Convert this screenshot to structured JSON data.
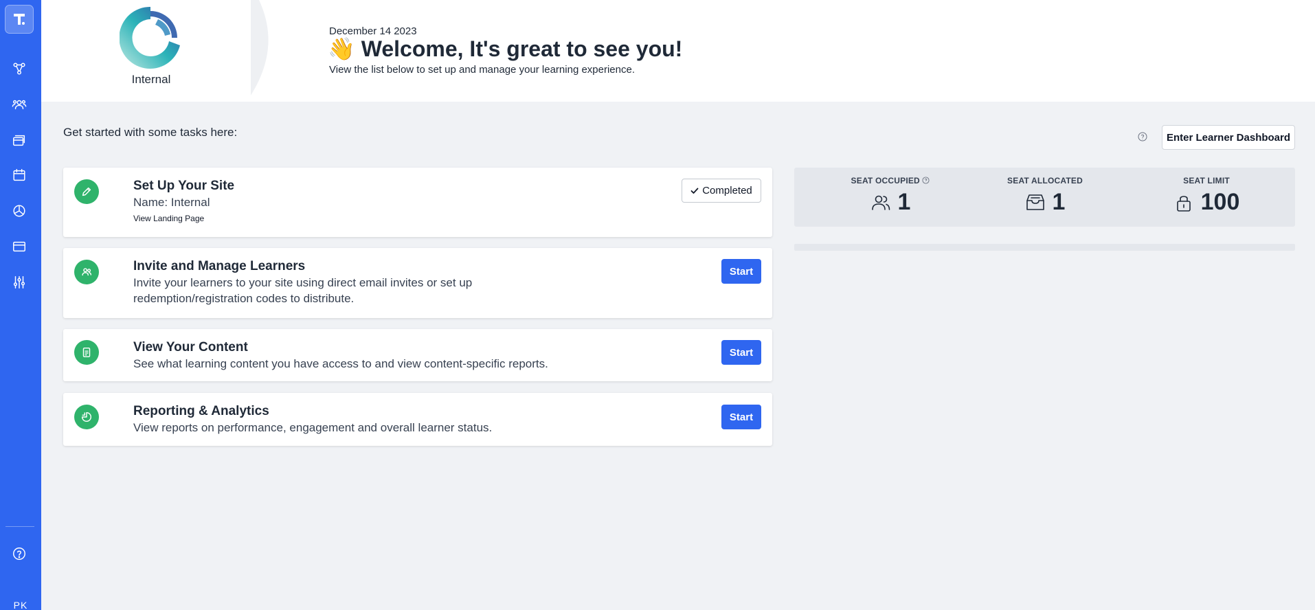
{
  "sidebar": {
    "user_initials": "PK",
    "items": [
      {
        "icon": "workflow-icon"
      },
      {
        "icon": "users-icon"
      },
      {
        "icon": "layers-icon"
      },
      {
        "icon": "calendar-icon"
      },
      {
        "icon": "pie-chart-icon"
      },
      {
        "icon": "browser-icon"
      },
      {
        "icon": "sliders-icon"
      }
    ],
    "help_icon": "help-circle-icon"
  },
  "header": {
    "org_name": "Internal",
    "date": "December 14 2023",
    "welcome_emoji": "👋",
    "welcome_text": "Welcome, It's great to see you!",
    "subtitle": "View the list below to set up and manage your learning experience."
  },
  "main": {
    "tasks_heading": "Get started with some tasks here:",
    "learner_dashboard_button": "Enter Learner Dashboard",
    "tasks": [
      {
        "title": "Set Up Your Site",
        "desc": "Name: Internal",
        "link": "View Landing Page",
        "status": "Completed",
        "icon": "pencil-icon"
      },
      {
        "title": "Invite and Manage Learners",
        "desc": "Invite your learners to your site using direct email invites or set up redemption/registration codes to distribute.",
        "button": "Start",
        "icon": "users-icon"
      },
      {
        "title": "View Your Content",
        "desc": "See what learning content you have access to and view content-specific reports.",
        "button": "Start",
        "icon": "document-icon"
      },
      {
        "title": "Reporting & Analytics",
        "desc": "View reports on performance, engagement and overall learner status.",
        "button": "Start",
        "icon": "chart-icon"
      }
    ]
  },
  "stats": {
    "seat_occupied": {
      "label": "SEAT OCCUPIED",
      "value": "1"
    },
    "seat_allocated": {
      "label": "SEAT ALLOCATED",
      "value": "1"
    },
    "seat_limit": {
      "label": "SEAT LIMIT",
      "value": "100"
    }
  },
  "colors": {
    "sidebar": "#2f66f0",
    "primary_button": "#2f66f0",
    "task_icon": "#2fb36b",
    "background": "#f0f2f5"
  }
}
